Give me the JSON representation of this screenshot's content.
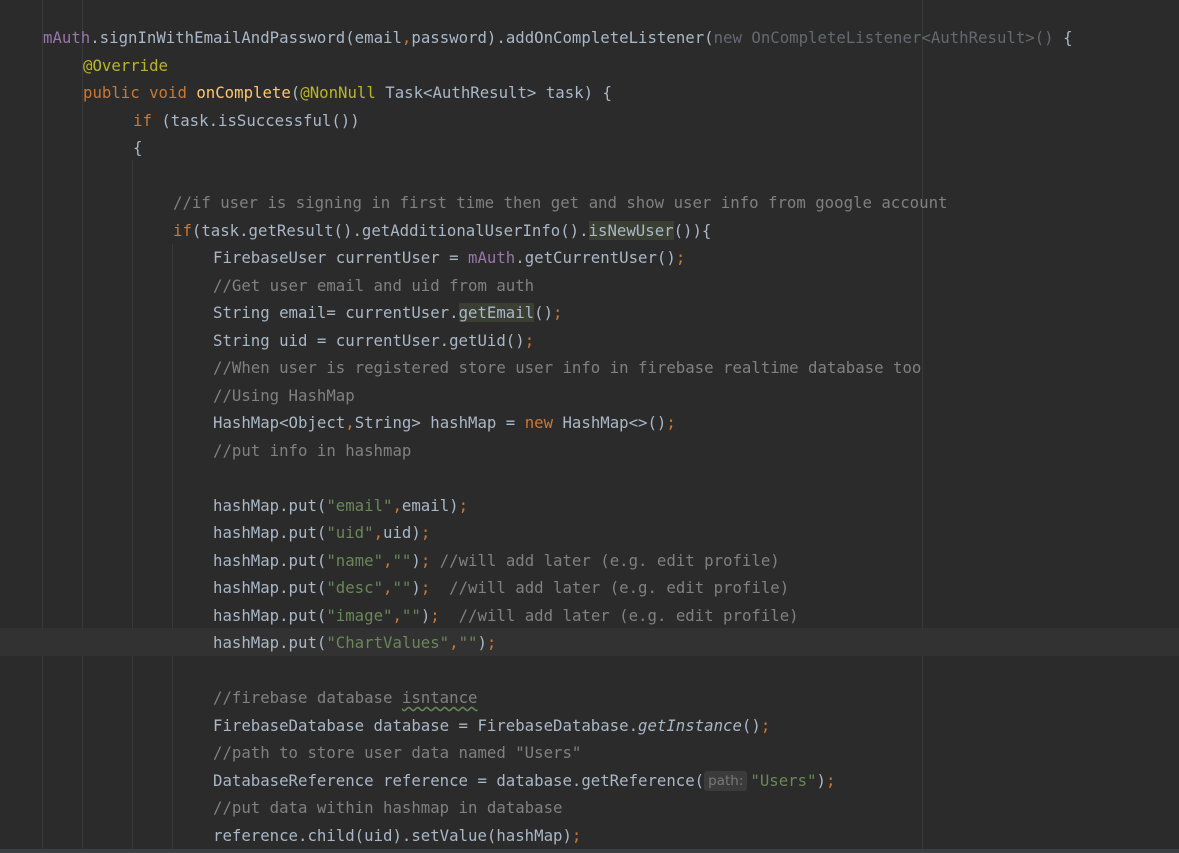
{
  "editor": {
    "lines": [
      {
        "text": "mAuth.signInWithEmailAndPassword(email,password).addOnCompleteListener(new OnCompleteListener<AuthResult>() {"
      },
      {
        "text": "@Override"
      },
      {
        "text": "public void onComplete(@NonNull Task<AuthResult> task) {"
      },
      {
        "text": "if (task.isSuccessful())"
      },
      {
        "text": "{"
      },
      {
        "text": ""
      },
      {
        "text": "//if user is signing in first time then get and show user info from google account"
      },
      {
        "text": "if(task.getResult().getAdditionalUserInfo().isNewUser()){"
      },
      {
        "text": "FirebaseUser currentUser = mAuth.getCurrentUser();"
      },
      {
        "text": "//Get user email and uid from auth"
      },
      {
        "text": "String email= currentUser.getEmail();"
      },
      {
        "text": "String uid = currentUser.getUid();"
      },
      {
        "text": "//When user is registered store user info in firebase realtime database too"
      },
      {
        "text": "//Using HashMap"
      },
      {
        "text": "HashMap<Object,String> hashMap = new HashMap<>();"
      },
      {
        "text": "//put info in hashmap"
      },
      {
        "text": ""
      },
      {
        "text": "hashMap.put(\"email\",email);"
      },
      {
        "text": "hashMap.put(\"uid\",uid);"
      },
      {
        "text": "hashMap.put(\"name\",\"\"); //will add later (e.g. edit profile)"
      },
      {
        "text": "hashMap.put(\"desc\",\"\");  //will add later (e.g. edit profile)"
      },
      {
        "text": "hashMap.put(\"image\",\"\");  //will add later (e.g. edit profile)"
      },
      {
        "text": "hashMap.put(\"ChartValues\",\"\");"
      },
      {
        "text": ""
      },
      {
        "text": "//firebase database isntance"
      },
      {
        "text": "FirebaseDatabase database = FirebaseDatabase.getInstance();"
      },
      {
        "text": "//path to store user data named \"Users\""
      },
      {
        "text": "DatabaseReference reference = database.getReference( path: \"Users\");"
      },
      {
        "text": "//put data within hashmap in database"
      },
      {
        "text": "reference.child(uid).setValue(hashMap);"
      }
    ],
    "tokens": {
      "l0": [
        "mAuth",
        ".signInWithEmailAndPassword(email",
        ",",
        "password).addOnCompleteListener(",
        "new OnCompleteListener<AuthResult>() ",
        "{"
      ],
      "l1": [
        "@Override"
      ],
      "l2": [
        "public void ",
        "onComplete",
        "(",
        "@NonNull",
        " Task<AuthResult> task) {"
      ],
      "l3": [
        "if ",
        "(task.isSuccessful())"
      ],
      "l4": [
        "{"
      ],
      "l6": [
        "//if user is signing in first time then get and show user info from google account"
      ],
      "l7": [
        "if",
        "(task.getResult().getAdditionalUserInfo().",
        "isNewUser",
        "()){"
      ],
      "l8": [
        "FirebaseUser currentUser = ",
        "mAuth",
        ".getCurrentUser()",
        ";"
      ],
      "l9": [
        "//Get user email and uid from auth"
      ],
      "l10": [
        "String email= currentUser.",
        "getEmail",
        "()",
        ";"
      ],
      "l11": [
        "String uid = currentUser.getUid()",
        ";"
      ],
      "l12": [
        "//When user is registered store user info in firebase realtime database too"
      ],
      "l13": [
        "//Using HashMap"
      ],
      "l14": [
        "HashMap<Object",
        ",",
        "String> hashMap = ",
        "new ",
        "HashMap<>()",
        ";"
      ],
      "l15": [
        "//put info in hashmap"
      ],
      "l17": [
        "hashMap.put(",
        "\"email\"",
        ",",
        "email)",
        ";"
      ],
      "l18": [
        "hashMap.put(",
        "\"uid\"",
        ",",
        "uid)",
        ";"
      ],
      "l19": [
        "hashMap.put(",
        "\"name\"",
        ",",
        "\"\"",
        ")",
        "; ",
        "//will add later (e.g. edit profile)"
      ],
      "l20": [
        "hashMap.put(",
        "\"desc\"",
        ",",
        "\"\"",
        ")",
        ";  ",
        "//will add later (e.g. edit profile)"
      ],
      "l21": [
        "hashMap.put(",
        "\"image\"",
        ",",
        "\"\"",
        ")",
        ";  ",
        "//will add later (e.g. edit profile)"
      ],
      "l22": [
        "hashMap.put(",
        "\"ChartValues\"",
        ",",
        "\"\"",
        ")",
        ";"
      ],
      "l24": [
        "//firebase database ",
        "isntance"
      ],
      "l25": [
        "FirebaseDatabase database = FirebaseDatabase.",
        "getInstance",
        "()",
        ";"
      ],
      "l26": [
        "//path to store user data named \"Users\""
      ],
      "l27": [
        "DatabaseReference reference = database.getReference(",
        "path:",
        "\"Users\"",
        ")",
        ";"
      ],
      "l28": [
        "//put data within hashmap in database"
      ],
      "l29": [
        "reference.child(uid).setValue(hashMap)",
        ";"
      ]
    }
  },
  "colors": {
    "background": "#2b2b2b",
    "keyword": "#cc7832",
    "field": "#9876aa",
    "method": "#ffc66d",
    "annotation": "#bbb529",
    "string": "#6a8759",
    "comment": "#808080",
    "text": "#a9b7c6"
  }
}
